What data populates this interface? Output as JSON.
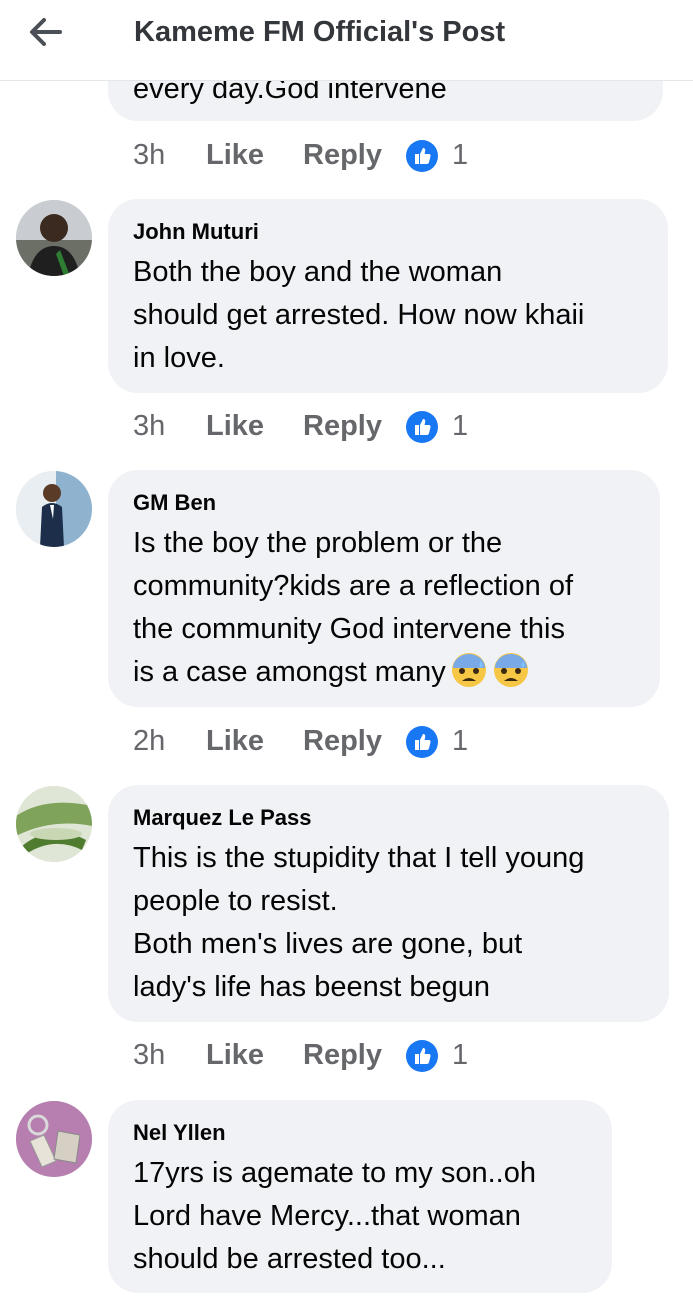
{
  "header": {
    "title": "Kameme FM Official's Post"
  },
  "top_fragment": {
    "text": "every day.God intervene",
    "time": "3h",
    "like_label": "Like",
    "reply_label": "Reply",
    "reactions": "1"
  },
  "comments": [
    {
      "name": "John Muturi",
      "text": " Both the boy and the woman\nshould get arrested. How now khaii\nin love.",
      "time": "3h",
      "like_label": "Like",
      "reply_label": "Reply",
      "reactions": "1"
    },
    {
      "name": "GM Ben",
      "text": "Is the boy the problem or the\ncommunity?kids are a reflection of\nthe community God intervene this\nis a case amongst many",
      "emojis": [
        "anxious-face-with-sweat",
        "anxious-face-with-sweat"
      ],
      "time": "2h",
      "like_label": "Like",
      "reply_label": "Reply",
      "reactions": "1"
    },
    {
      "name": "Marquez Le Pass",
      "text": "This is the stupidity that I tell young\npeople to resist.\nBoth men's lives are gone, but\nlady's life has beenst begun",
      "time": "3h",
      "like_label": "Like",
      "reply_label": "Reply",
      "reactions": "1"
    },
    {
      "name": "Nel Yllen",
      "text": "17yrs is agemate to my son..oh\nLord have Mercy...that woman\nshould be arrested too..."
    }
  ],
  "colors": {
    "bubble": "#f0f2f5",
    "meta_text": "#65676b",
    "like_blue": "#1877f2",
    "header_text": "#33363b"
  },
  "icons": {
    "back": "arrow-left-icon",
    "like_badge": "thumbs-up-icon"
  }
}
